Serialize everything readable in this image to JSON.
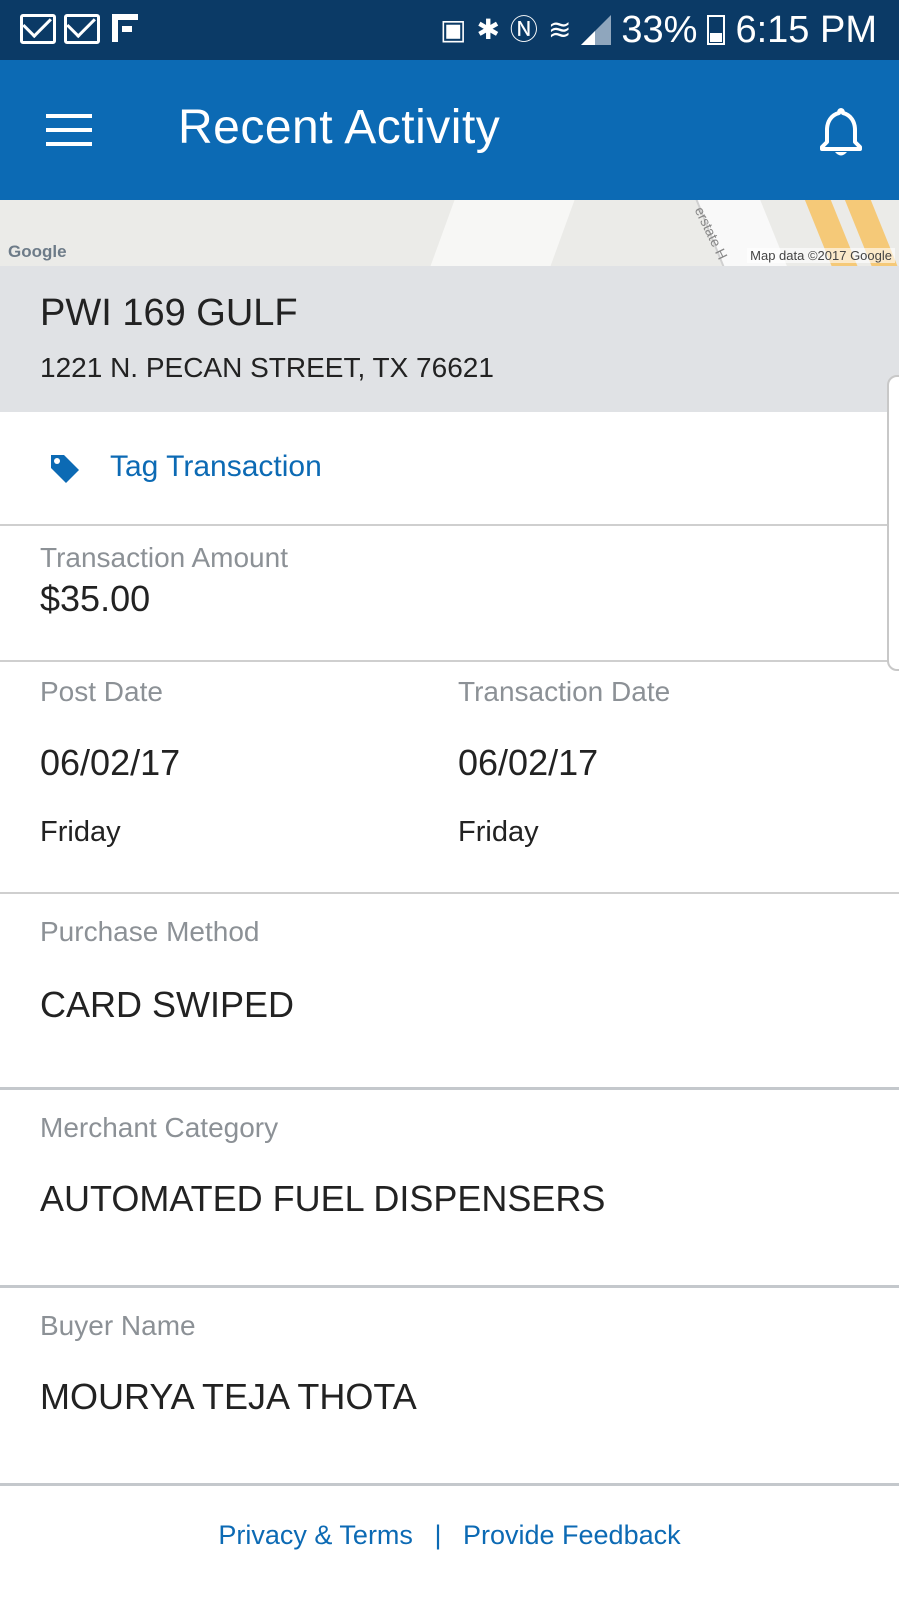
{
  "status_bar": {
    "battery": "33%",
    "time": "6:15 PM"
  },
  "app_bar": {
    "title": "Recent Activity"
  },
  "map": {
    "logo": "Google",
    "attribution": "Map data ©2017 Google",
    "road_label": "erstate H"
  },
  "merchant": {
    "name": "PWI 169 GULF",
    "address": "1221 N. PECAN STREET, TX 76621"
  },
  "tag": {
    "label": "Tag Transaction"
  },
  "transaction": {
    "amount_label": "Transaction Amount",
    "amount": "$35.00",
    "post_date_label": "Post Date",
    "post_date": "06/02/17",
    "post_day": "Friday",
    "transaction_date_label": "Transaction Date",
    "transaction_date": "06/02/17",
    "transaction_day": "Friday",
    "purchase_method_label": "Purchase Method",
    "purchase_method": "CARD SWIPED",
    "merchant_category_label": "Merchant Category",
    "merchant_category": "AUTOMATED FUEL DISPENSERS",
    "buyer_name_label": "Buyer Name",
    "buyer_name": "MOURYA TEJA THOTA"
  },
  "footer": {
    "privacy_label": "Privacy & Terms",
    "separator": "|",
    "feedback_label": "Provide Feedback"
  },
  "colors": {
    "status_bar": "#0b3a66",
    "app_bar": "#0c6ab4",
    "link": "#0c6ab4",
    "header_bg": "#e0e2e5"
  }
}
